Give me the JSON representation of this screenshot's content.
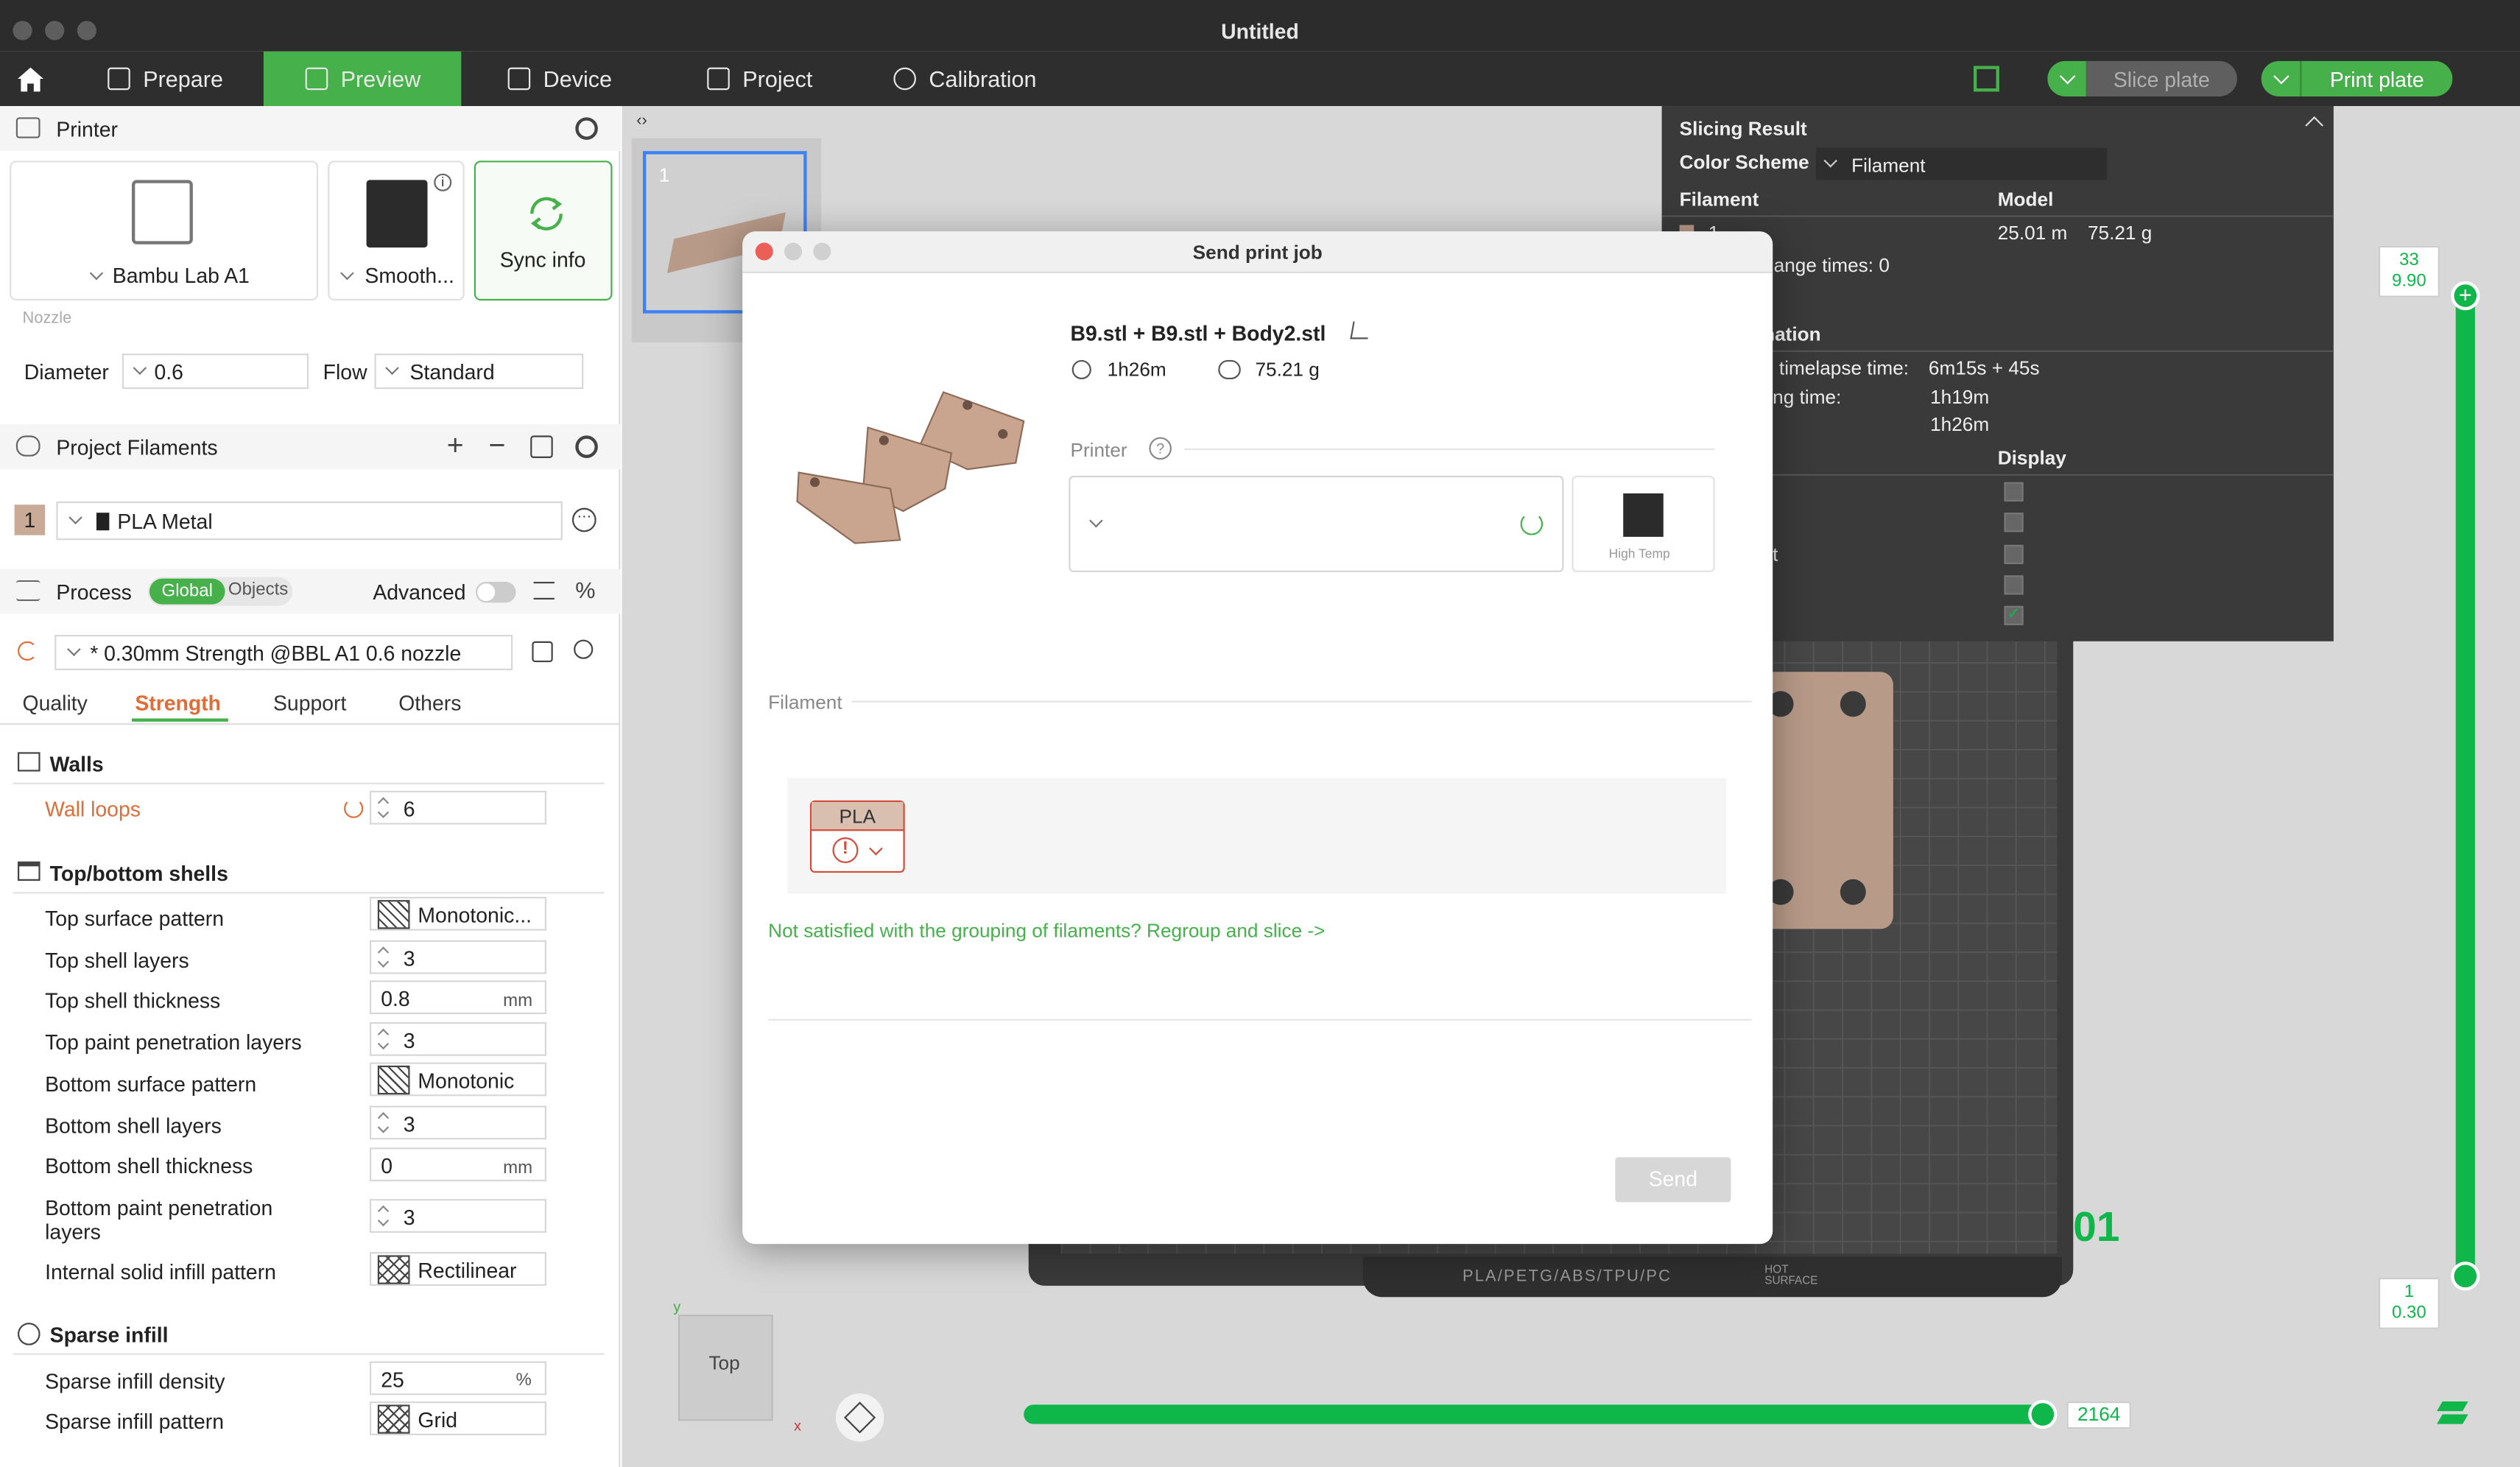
{
  "window": {
    "title": "Untitled"
  },
  "nav": {
    "items": [
      {
        "label": "Prepare"
      },
      {
        "label": "Preview"
      },
      {
        "label": "Device"
      },
      {
        "label": "Project"
      },
      {
        "label": "Calibration"
      }
    ],
    "slice_label": "Slice plate",
    "print_label": "Print plate"
  },
  "printer": {
    "section_title": "Printer",
    "name": "Bambu Lab A1",
    "plate": "Smooth...",
    "sync_label": "Sync info",
    "nozzle_label": "Nozzle",
    "diameter_label": "Diameter",
    "diameter_value": "0.6",
    "flow_label": "Flow",
    "flow_value": "Standard"
  },
  "filaments": {
    "section_title": "Project Filaments",
    "items": [
      {
        "index": "1",
        "name": "PLA Metal"
      }
    ]
  },
  "process": {
    "section_title": "Process",
    "toggle_global": "Global",
    "toggle_objects": "Objects",
    "advanced_label": "Advanced",
    "preset": "* 0.30mm Strength @BBL A1 0.6 nozzle",
    "tabs": [
      "Quality",
      "Strength",
      "Support",
      "Others"
    ],
    "active_tab": "Strength"
  },
  "settings": {
    "walls_title": "Walls",
    "wall_loops_label": "Wall loops",
    "wall_loops_value": "6",
    "topbottom_title": "Top/bottom shells",
    "rows": [
      {
        "label": "Top surface pattern",
        "value": "Monotonic..."
      },
      {
        "label": "Top shell layers",
        "value": "3"
      },
      {
        "label": "Top shell thickness",
        "value": "0.8",
        "unit": "mm"
      },
      {
        "label": "Top paint penetration layers",
        "value": "3"
      },
      {
        "label": "Bottom surface pattern",
        "value": "Monotonic"
      },
      {
        "label": "Bottom shell layers",
        "value": "3"
      },
      {
        "label": "Bottom shell thickness",
        "value": "0",
        "unit": "mm"
      },
      {
        "label": "Bottom paint penetration layers",
        "value": "3"
      },
      {
        "label": "Internal solid infill pattern",
        "value": "Rectilinear"
      }
    ],
    "sparse_title": "Sparse infill",
    "sparse_rows": [
      {
        "label": "Sparse infill density",
        "value": "25",
        "unit": "%"
      },
      {
        "label": "Sparse infill pattern",
        "value": "Grid"
      }
    ]
  },
  "canvas": {
    "plate_number": "1",
    "bed_number": "01",
    "bed_text": "PLA/PETG/ABS/TPU/PC",
    "bed_hot": "HOT SURFACE",
    "view_cube_label": "Top",
    "axis_x": "x",
    "axis_y": "y",
    "layer_top": "33",
    "height_top": "9.90",
    "layer_bottom": "1",
    "height_bottom": "0.30",
    "h_slider_value": "2164",
    "h_slider_fraction": 0.99
  },
  "result": {
    "title": "Slicing Result",
    "color_scheme_label": "Color Scheme",
    "color_scheme_value": "Filament",
    "col_filament": "Filament",
    "col_model": "Model",
    "model_length": "25.01 m",
    "model_weight": "75.21 g",
    "row_1": "1",
    "change_times": "hange times:  0",
    "info_title": "nation",
    "timelapse_label": "d timelapse time:",
    "timelapse_value": "6m15s + 45s",
    "printing_label": "ting time:",
    "printing_value": "1h19m",
    "total_value": "1h26m",
    "display_label": "Display",
    "partial_label": "ct"
  },
  "dialog": {
    "title": "Send print job",
    "file_name": "B9.stl + B9.stl + Body2.stl",
    "time": "1h26m",
    "weight": "75.21 g",
    "printer_label": "Printer",
    "plate_label": "High Temp",
    "filament_label": "Filament",
    "filament_chip": "PLA",
    "regroup_text": "Not satisfied with the grouping of filaments? Regroup and slice ->",
    "send_label": "Send"
  },
  "colors": {
    "accent": "#46b04b",
    "slider": "#0fb64a",
    "strength_tab": "#e06c37",
    "warning": "#d34c3a"
  }
}
